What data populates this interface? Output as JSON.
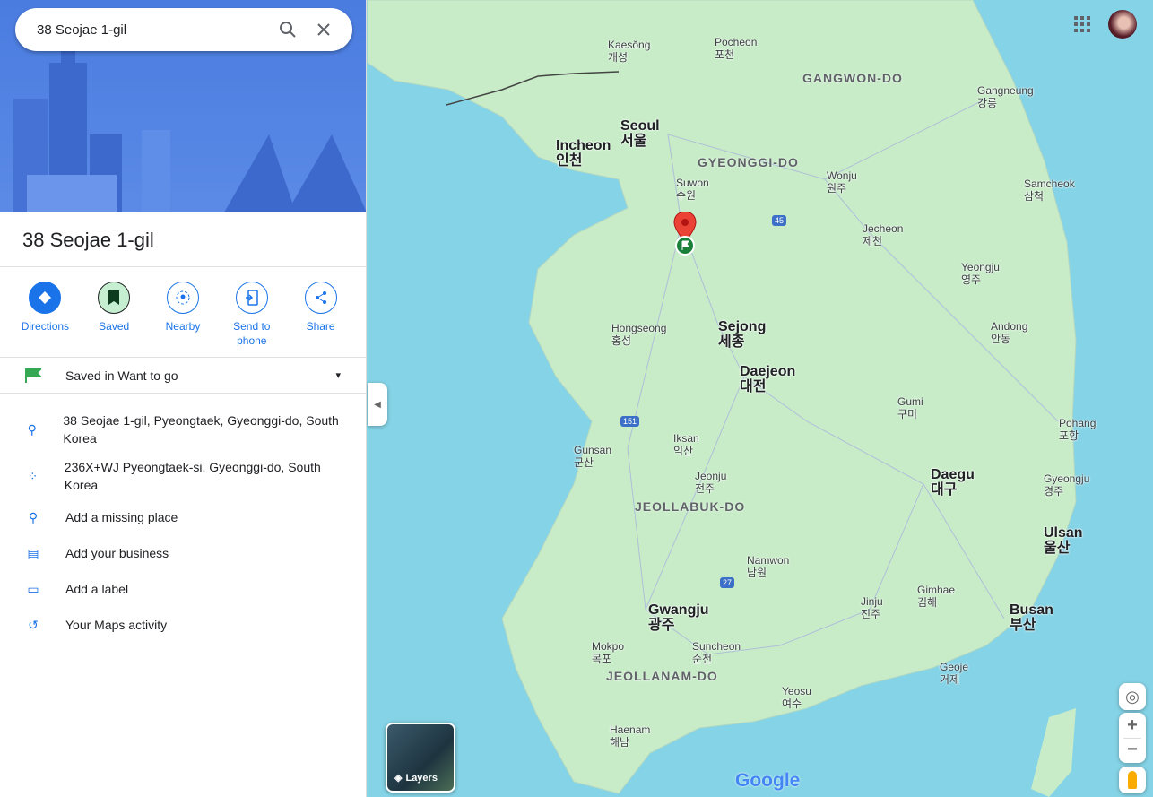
{
  "search": {
    "query": "38 Seojae 1-gil",
    "search_icon": "search-icon",
    "close_icon": "close-icon"
  },
  "place": {
    "title": "38 Seojae 1-gil"
  },
  "actions": [
    {
      "label": "Directions",
      "icon": "directions-icon"
    },
    {
      "label": "Saved",
      "icon": "bookmark-icon"
    },
    {
      "label": "Nearby",
      "icon": "nearby-icon"
    },
    {
      "label": "Send to phone",
      "icon": "send-to-phone-icon"
    },
    {
      "label": "Share",
      "icon": "share-icon"
    }
  ],
  "saved": {
    "label": "Saved in Want to go",
    "icon": "green-flag-icon"
  },
  "details": [
    {
      "text": "38 Seojae 1-gil, Pyeongtaek, Gyeonggi-do, South Korea",
      "icon": "location-pin-icon"
    },
    {
      "text": "236X+WJ Pyeongtaek-si, Gyeonggi-do, South Korea",
      "icon": "plus-code-icon"
    },
    {
      "text": "Add a missing place",
      "icon": "add-place-icon"
    },
    {
      "text": "Add your business",
      "icon": "add-business-icon"
    },
    {
      "text": "Add a label",
      "icon": "label-icon"
    },
    {
      "text": "Your Maps activity",
      "icon": "history-icon"
    }
  ],
  "map": {
    "layers_label": "Layers",
    "logo": "Google",
    "colors": {
      "water": "#85d3e6",
      "land": "#c8ecc8",
      "accent": "#1a73e8",
      "pin": "#ea4335"
    },
    "regions": [
      "GANGWON-DO",
      "GYEONGGI-DO",
      "JEOLLABUK-DO",
      "JEOLLANAM-DO"
    ],
    "cities": [
      {
        "en": "Seoul",
        "ko": "서울"
      },
      {
        "en": "Incheon",
        "ko": "인천"
      },
      {
        "en": "Suwon",
        "ko": "수원"
      },
      {
        "en": "Kaesŏng",
        "ko": "개성"
      },
      {
        "en": "Gangneung",
        "ko": "강릉"
      },
      {
        "en": "Wonju",
        "ko": "원주"
      },
      {
        "en": "Sejong",
        "ko": "세종"
      },
      {
        "en": "Daejeon",
        "ko": "대전"
      },
      {
        "en": "Daegu",
        "ko": "대구"
      },
      {
        "en": "Ulsan",
        "ko": "울산"
      },
      {
        "en": "Busan",
        "ko": "부산"
      },
      {
        "en": "Gwangju",
        "ko": "광주"
      },
      {
        "en": "Jeonju",
        "ko": "전주"
      },
      {
        "en": "Pohang",
        "ko": "포항"
      },
      {
        "en": "Gumi",
        "ko": "구미"
      },
      {
        "en": "Jinju",
        "ko": "진주"
      },
      {
        "en": "Iksan",
        "ko": "익산"
      },
      {
        "en": "Gunsan",
        "ko": "군산"
      },
      {
        "en": "Suncheon",
        "ko": "순천"
      },
      {
        "en": "Yeosu",
        "ko": "여수"
      },
      {
        "en": "Gimhae",
        "ko": "김해"
      },
      {
        "en": "Geoje",
        "ko": "거제"
      },
      {
        "en": "Andong",
        "ko": "안동"
      },
      {
        "en": "Hongseong",
        "ko": "홍성"
      },
      {
        "en": "Pocheon",
        "ko": "포천"
      },
      {
        "en": "Jecheon",
        "ko": "제천"
      },
      {
        "en": "Yeongju",
        "ko": "영주"
      },
      {
        "en": "Samcheok",
        "ko": "삼척"
      },
      {
        "en": "Gyeongju",
        "ko": "경주"
      },
      {
        "en": "Mokpo",
        "ko": "목포"
      },
      {
        "en": "Haenam",
        "ko": "해남"
      },
      {
        "en": "Namwon",
        "ko": "남원"
      }
    ],
    "highways": [
      "45",
      "151",
      "27"
    ]
  }
}
